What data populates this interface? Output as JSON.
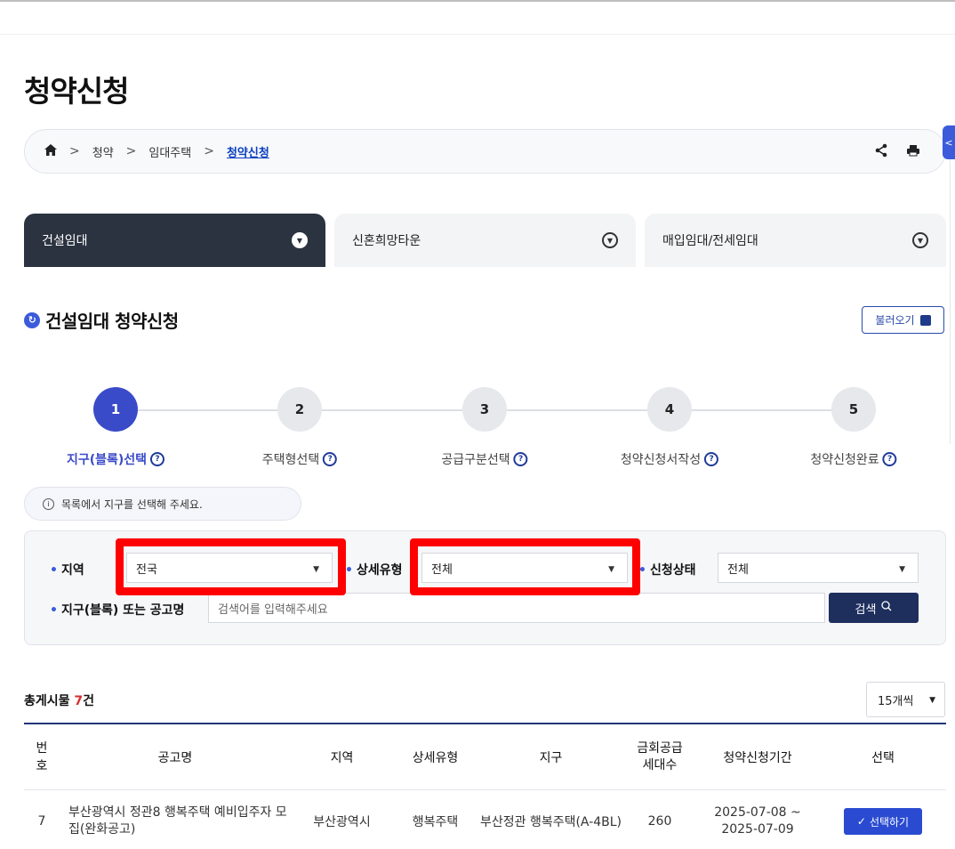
{
  "page_title": "청약신청",
  "breadcrumb": {
    "items": [
      "청약",
      "임대주택"
    ],
    "current": "청약신청"
  },
  "tabs": [
    {
      "label": "건설임대",
      "active": true
    },
    {
      "label": "신혼희망타운",
      "active": false
    },
    {
      "label": "매입임대/전세임대",
      "active": false
    }
  ],
  "section": {
    "title": "건설임대 청약신청",
    "load_button": "불러오기"
  },
  "steps": [
    {
      "num": "1",
      "label": "지구(블록)선택"
    },
    {
      "num": "2",
      "label": "주택형선택"
    },
    {
      "num": "3",
      "label": "공급구분선택"
    },
    {
      "num": "4",
      "label": "청약신청서작성"
    },
    {
      "num": "5",
      "label": "청약신청완료"
    }
  ],
  "notice": "목록에서 지구를 선택해 주세요.",
  "filters": {
    "region_label": "지역",
    "region_value": "전국",
    "type_label": "상세유형",
    "type_value": "전체",
    "status_label": "신청상태",
    "status_value": "전체",
    "keyword_label": "지구(블록) 또는 공고명",
    "keyword_placeholder": "검색어를 입력해주세요",
    "search_button": "검색"
  },
  "results": {
    "prefix": "총게시물",
    "count": "7",
    "suffix": "건",
    "page_size": "15개씩"
  },
  "table": {
    "headers": {
      "no": "번호",
      "title": "공고명",
      "region": "지역",
      "type": "상세유형",
      "district": "지구",
      "units": "금회공급세대수",
      "period": "청약신청기간",
      "select": "선택"
    },
    "rows": [
      {
        "no": "7",
        "title": "부산광역시 정관8 행복주택 예비입주자 모집(완화공고)",
        "region": "부산광역시",
        "type": "행복주택",
        "district": "부산정관 행복주택(A-4BL)",
        "units": "260",
        "period": "2025-07-08 ~ 2025-07-09",
        "button": "선택하기"
      }
    ]
  }
}
